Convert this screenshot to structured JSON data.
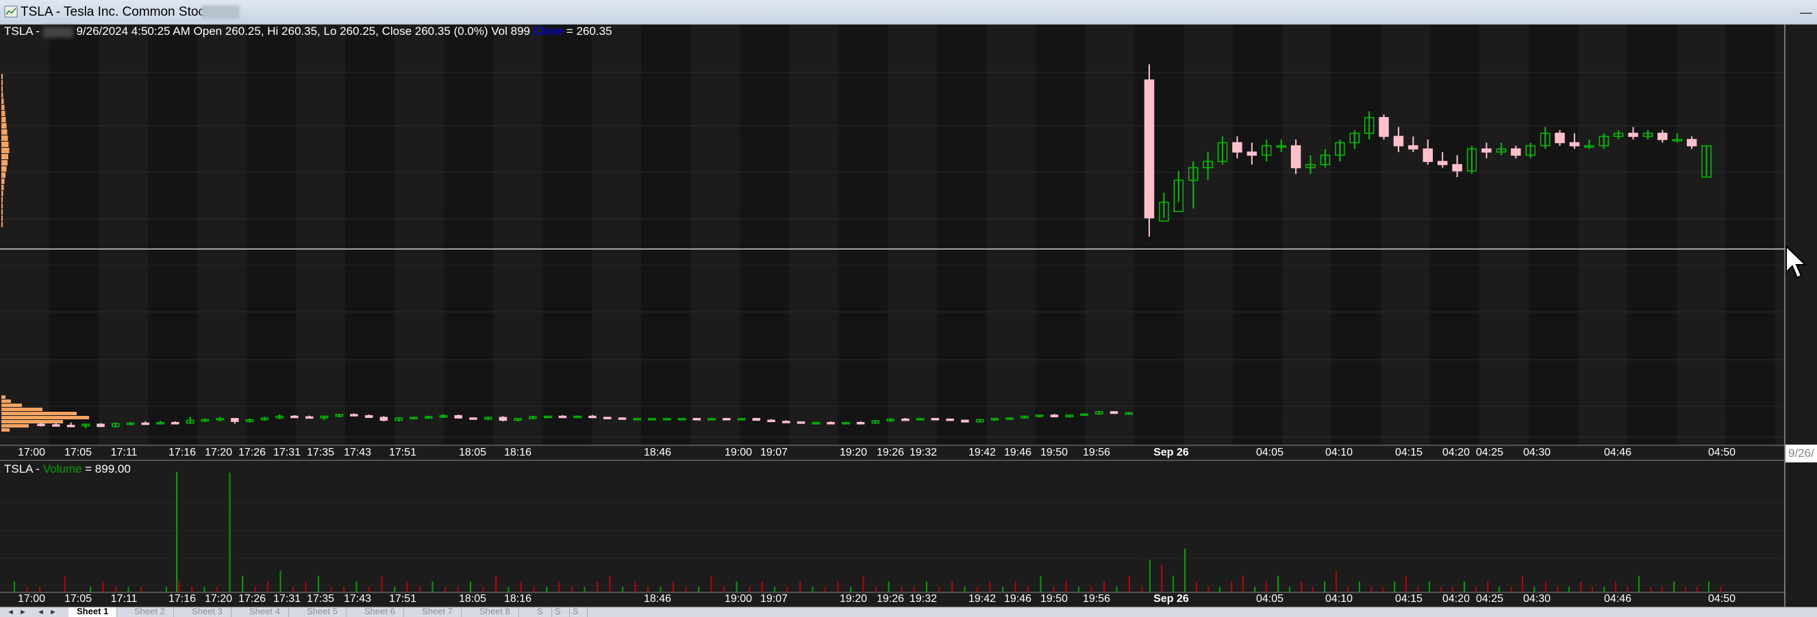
{
  "window": {
    "title": "TSLA - Tesla Inc. Common Stock",
    "minimize_glyph": "—"
  },
  "price_header": {
    "symbol": "TSLA -",
    "details": "9/26/2024 4:50:25 AM Open 260.25, Hi 260.35, Lo 260.25, Close 260.35 (0.0%) Vol 899",
    "close_label": "Close",
    "close_value": "= 260.35"
  },
  "volume_header": {
    "symbol": "TSLA -",
    "label": "Volume",
    "value": "= 899.00"
  },
  "date_tag": "9/26/",
  "colors": {
    "background": "#1c1c1c",
    "band_dark": "#141414",
    "up_candle": "#00c000",
    "down_candle": "#ffc0cb",
    "volume_up": "#00a000",
    "volume_down": "#c00000",
    "volume_profile": "#f4a460",
    "close_label": "#0000ff",
    "volume_label": "#00a000"
  },
  "icons": {
    "window": "chart-window-icon",
    "cursor": "mouse-pointer-icon"
  },
  "x_axis_labels": [
    {
      "text": "17:00",
      "bold": false
    },
    {
      "text": "17:05",
      "bold": false
    },
    {
      "text": "17:11",
      "bold": false
    },
    {
      "text": "17:16",
      "bold": false
    },
    {
      "text": "17:20",
      "bold": false
    },
    {
      "text": "17:26",
      "bold": false
    },
    {
      "text": "17:31",
      "bold": false
    },
    {
      "text": "17:35",
      "bold": false
    },
    {
      "text": "17:43",
      "bold": false
    },
    {
      "text": "17:51",
      "bold": false
    },
    {
      "text": "18:05",
      "bold": false
    },
    {
      "text": "18:16",
      "bold": false
    },
    {
      "text": "18:46",
      "bold": false
    },
    {
      "text": "19:00",
      "bold": false
    },
    {
      "text": "19:07",
      "bold": false
    },
    {
      "text": "19:20",
      "bold": false
    },
    {
      "text": "19:26",
      "bold": false
    },
    {
      "text": "19:32",
      "bold": false
    },
    {
      "text": "19:42",
      "bold": false
    },
    {
      "text": "19:46",
      "bold": false
    },
    {
      "text": "19:50",
      "bold": false
    },
    {
      "text": "19:56",
      "bold": false
    },
    {
      "text": "Sep 26",
      "bold": true
    },
    {
      "text": "04:05",
      "bold": false
    },
    {
      "text": "04:10",
      "bold": false
    },
    {
      "text": "04:15",
      "bold": false
    },
    {
      "text": "04:20",
      "bold": false
    },
    {
      "text": "04:25",
      "bold": false
    },
    {
      "text": "04:30",
      "bold": false
    },
    {
      "text": "04:46",
      "bold": false
    },
    {
      "text": "04:50",
      "bold": false
    }
  ],
  "sheet_nav": [
    "◄",
    "►",
    "◄",
    "►"
  ],
  "sheets": [
    "Sheet 1",
    "Sheet 2",
    "Sheet 3",
    "Sheet 4",
    "Sheet 5",
    "Sheet 6",
    "Sheet 7",
    "Sheet 8",
    "S",
    "S",
    "S"
  ],
  "active_sheet": 0,
  "chart_data": {
    "type": "candlestick",
    "symbol": "TSLA",
    "sessions": [
      {
        "label": "Sep 25 evening (17:00–19:56)",
        "candles": [
          {
            "o": 259.73,
            "h": 259.77,
            "l": 259.69,
            "c": 259.72
          },
          {
            "o": 259.72,
            "h": 259.75,
            "l": 259.7,
            "c": 259.71
          },
          {
            "o": 259.71,
            "h": 259.76,
            "l": 259.68,
            "c": 259.7
          },
          {
            "o": 259.7,
            "h": 259.74,
            "l": 259.66,
            "c": 259.73
          },
          {
            "o": 259.73,
            "h": 259.75,
            "l": 259.68,
            "c": 259.69
          },
          {
            "o": 259.69,
            "h": 259.76,
            "l": 259.67,
            "c": 259.74
          },
          {
            "o": 259.74,
            "h": 259.77,
            "l": 259.71,
            "c": 259.75
          },
          {
            "o": 259.75,
            "h": 259.78,
            "l": 259.72,
            "c": 259.74
          },
          {
            "o": 259.74,
            "h": 259.79,
            "l": 259.73,
            "c": 259.76
          },
          {
            "o": 259.76,
            "h": 259.78,
            "l": 259.73,
            "c": 259.75
          },
          {
            "o": 259.75,
            "h": 259.86,
            "l": 259.74,
            "c": 259.8
          },
          {
            "o": 259.8,
            "h": 259.83,
            "l": 259.77,
            "c": 259.81
          },
          {
            "o": 259.81,
            "h": 259.86,
            "l": 259.78,
            "c": 259.83
          },
          {
            "o": 259.83,
            "h": 259.84,
            "l": 259.74,
            "c": 259.78
          },
          {
            "o": 259.78,
            "h": 259.83,
            "l": 259.76,
            "c": 259.81
          },
          {
            "o": 259.81,
            "h": 259.86,
            "l": 259.79,
            "c": 259.84
          },
          {
            "o": 259.84,
            "h": 259.9,
            "l": 259.82,
            "c": 259.87
          },
          {
            "o": 259.87,
            "h": 259.89,
            "l": 259.84,
            "c": 259.86
          },
          {
            "o": 259.86,
            "h": 259.88,
            "l": 259.83,
            "c": 259.84
          },
          {
            "o": 259.84,
            "h": 259.88,
            "l": 259.8,
            "c": 259.87
          },
          {
            "o": 259.87,
            "h": 259.91,
            "l": 259.85,
            "c": 259.9
          },
          {
            "o": 259.9,
            "h": 259.92,
            "l": 259.87,
            "c": 259.88
          },
          {
            "o": 259.88,
            "h": 259.9,
            "l": 259.84,
            "c": 259.85
          },
          {
            "o": 259.85,
            "h": 259.87,
            "l": 259.78,
            "c": 259.8
          },
          {
            "o": 259.8,
            "h": 259.85,
            "l": 259.78,
            "c": 259.84
          },
          {
            "o": 259.84,
            "h": 259.86,
            "l": 259.82,
            "c": 259.85
          },
          {
            "o": 259.85,
            "h": 259.88,
            "l": 259.83,
            "c": 259.86
          },
          {
            "o": 259.86,
            "h": 259.91,
            "l": 259.84,
            "c": 259.88
          },
          {
            "o": 259.88,
            "h": 259.9,
            "l": 259.83,
            "c": 259.84
          },
          {
            "o": 259.84,
            "h": 259.85,
            "l": 259.81,
            "c": 259.82
          },
          {
            "o": 259.82,
            "h": 259.86,
            "l": 259.8,
            "c": 259.85
          },
          {
            "o": 259.85,
            "h": 259.87,
            "l": 259.78,
            "c": 259.8
          },
          {
            "o": 259.8,
            "h": 259.84,
            "l": 259.78,
            "c": 259.83
          },
          {
            "o": 259.83,
            "h": 259.88,
            "l": 259.82,
            "c": 259.86
          },
          {
            "o": 259.86,
            "h": 259.88,
            "l": 259.85,
            "c": 259.87
          },
          {
            "o": 259.87,
            "h": 259.89,
            "l": 259.85,
            "c": 259.86
          },
          {
            "o": 259.86,
            "h": 259.88,
            "l": 259.85,
            "c": 259.87
          },
          {
            "o": 259.87,
            "h": 259.89,
            "l": 259.84,
            "c": 259.85
          },
          {
            "o": 259.85,
            "h": 259.86,
            "l": 259.83,
            "c": 259.84
          },
          {
            "o": 259.84,
            "h": 259.85,
            "l": 259.82,
            "c": 259.83
          },
          {
            "o": 259.83,
            "h": 259.84,
            "l": 259.82,
            "c": 259.83
          },
          {
            "o": 259.83,
            "h": 259.84,
            "l": 259.82,
            "c": 259.83
          },
          {
            "o": 259.83,
            "h": 259.84,
            "l": 259.82,
            "c": 259.83
          },
          {
            "o": 259.83,
            "h": 259.84,
            "l": 259.82,
            "c": 259.83
          },
          {
            "o": 259.83,
            "h": 259.84,
            "l": 259.81,
            "c": 259.82
          },
          {
            "o": 259.82,
            "h": 259.84,
            "l": 259.81,
            "c": 259.83
          },
          {
            "o": 259.83,
            "h": 259.84,
            "l": 259.8,
            "c": 259.81
          },
          {
            "o": 259.81,
            "h": 259.84,
            "l": 259.8,
            "c": 259.83
          },
          {
            "o": 259.83,
            "h": 259.84,
            "l": 259.79,
            "c": 259.8
          },
          {
            "o": 259.8,
            "h": 259.82,
            "l": 259.77,
            "c": 259.78
          },
          {
            "o": 259.78,
            "h": 259.8,
            "l": 259.76,
            "c": 259.77
          },
          {
            "o": 259.77,
            "h": 259.78,
            "l": 259.74,
            "c": 259.75
          },
          {
            "o": 259.75,
            "h": 259.77,
            "l": 259.73,
            "c": 259.76
          },
          {
            "o": 259.76,
            "h": 259.78,
            "l": 259.74,
            "c": 259.75
          },
          {
            "o": 259.75,
            "h": 259.77,
            "l": 259.74,
            "c": 259.76
          },
          {
            "o": 259.76,
            "h": 259.78,
            "l": 259.74,
            "c": 259.75
          },
          {
            "o": 259.75,
            "h": 259.8,
            "l": 259.74,
            "c": 259.79
          },
          {
            "o": 259.79,
            "h": 259.83,
            "l": 259.77,
            "c": 259.82
          },
          {
            "o": 259.82,
            "h": 259.84,
            "l": 259.79,
            "c": 259.81
          },
          {
            "o": 259.81,
            "h": 259.84,
            "l": 259.8,
            "c": 259.83
          },
          {
            "o": 259.83,
            "h": 259.84,
            "l": 259.81,
            "c": 259.82
          },
          {
            "o": 259.82,
            "h": 259.83,
            "l": 259.79,
            "c": 259.8
          },
          {
            "o": 259.8,
            "h": 259.81,
            "l": 259.76,
            "c": 259.77
          },
          {
            "o": 259.77,
            "h": 259.82,
            "l": 259.76,
            "c": 259.81
          },
          {
            "o": 259.81,
            "h": 259.84,
            "l": 259.79,
            "c": 259.83
          },
          {
            "o": 259.83,
            "h": 259.85,
            "l": 259.81,
            "c": 259.84
          },
          {
            "o": 259.84,
            "h": 259.88,
            "l": 259.83,
            "c": 259.87
          },
          {
            "o": 259.87,
            "h": 259.9,
            "l": 259.85,
            "c": 259.89
          },
          {
            "o": 259.89,
            "h": 259.91,
            "l": 259.85,
            "c": 259.86
          },
          {
            "o": 259.86,
            "h": 259.9,
            "l": 259.85,
            "c": 259.89
          },
          {
            "o": 259.89,
            "h": 259.92,
            "l": 259.88,
            "c": 259.91
          },
          {
            "o": 259.91,
            "h": 259.96,
            "l": 259.9,
            "c": 259.95
          },
          {
            "o": 259.95,
            "h": 259.96,
            "l": 259.91,
            "c": 259.92
          },
          {
            "o": 259.92,
            "h": 259.94,
            "l": 259.9,
            "c": 259.93
          }
        ]
      },
      {
        "label": "Sep 26 pre-market (04:00–04:50)",
        "candles": [
          {
            "o": 260.56,
            "h": 260.61,
            "l": 260.06,
            "c": 260.12
          },
          {
            "o": 260.11,
            "h": 260.2,
            "l": 260.12,
            "c": 260.17
          },
          {
            "o": 260.14,
            "h": 260.27,
            "l": 260.17,
            "c": 260.24
          },
          {
            "o": 260.24,
            "h": 260.3,
            "l": 260.15,
            "c": 260.28
          },
          {
            "o": 260.28,
            "h": 260.33,
            "l": 260.24,
            "c": 260.3
          },
          {
            "o": 260.3,
            "h": 260.38,
            "l": 260.29,
            "c": 260.36
          },
          {
            "o": 260.36,
            "h": 260.38,
            "l": 260.31,
            "c": 260.33
          },
          {
            "o": 260.33,
            "h": 260.36,
            "l": 260.29,
            "c": 260.32
          },
          {
            "o": 260.32,
            "h": 260.37,
            "l": 260.3,
            "c": 260.35
          },
          {
            "o": 260.35,
            "h": 260.37,
            "l": 260.33,
            "c": 260.35
          },
          {
            "o": 260.35,
            "h": 260.37,
            "l": 260.26,
            "c": 260.28
          },
          {
            "o": 260.28,
            "h": 260.32,
            "l": 260.26,
            "c": 260.29
          },
          {
            "o": 260.29,
            "h": 260.34,
            "l": 260.28,
            "c": 260.32
          },
          {
            "o": 260.32,
            "h": 260.37,
            "l": 260.3,
            "c": 260.36
          },
          {
            "o": 260.36,
            "h": 260.4,
            "l": 260.34,
            "c": 260.39
          },
          {
            "o": 260.39,
            "h": 260.46,
            "l": 260.37,
            "c": 260.44
          },
          {
            "o": 260.44,
            "h": 260.45,
            "l": 260.37,
            "c": 260.38
          },
          {
            "o": 260.38,
            "h": 260.41,
            "l": 260.33,
            "c": 260.35
          },
          {
            "o": 260.35,
            "h": 260.38,
            "l": 260.33,
            "c": 260.34
          },
          {
            "o": 260.34,
            "h": 260.37,
            "l": 260.29,
            "c": 260.3
          },
          {
            "o": 260.3,
            "h": 260.33,
            "l": 260.28,
            "c": 260.29
          },
          {
            "o": 260.29,
            "h": 260.32,
            "l": 260.25,
            "c": 260.27
          },
          {
            "o": 260.27,
            "h": 260.35,
            "l": 260.26,
            "c": 260.34
          },
          {
            "o": 260.34,
            "h": 260.36,
            "l": 260.31,
            "c": 260.33
          },
          {
            "o": 260.33,
            "h": 260.36,
            "l": 260.32,
            "c": 260.34
          },
          {
            "o": 260.34,
            "h": 260.35,
            "l": 260.31,
            "c": 260.32
          },
          {
            "o": 260.32,
            "h": 260.36,
            "l": 260.31,
            "c": 260.35
          },
          {
            "o": 260.35,
            "h": 260.41,
            "l": 260.34,
            "c": 260.39
          },
          {
            "o": 260.39,
            "h": 260.4,
            "l": 260.35,
            "c": 260.36
          },
          {
            "o": 260.36,
            "h": 260.39,
            "l": 260.34,
            "c": 260.35
          },
          {
            "o": 260.35,
            "h": 260.37,
            "l": 260.34,
            "c": 260.35
          },
          {
            "o": 260.35,
            "h": 260.39,
            "l": 260.34,
            "c": 260.38
          },
          {
            "o": 260.38,
            "h": 260.4,
            "l": 260.37,
            "c": 260.39
          },
          {
            "o": 260.39,
            "h": 260.41,
            "l": 260.37,
            "c": 260.38
          },
          {
            "o": 260.38,
            "h": 260.4,
            "l": 260.37,
            "c": 260.39
          },
          {
            "o": 260.39,
            "h": 260.4,
            "l": 260.36,
            "c": 260.37
          },
          {
            "o": 260.37,
            "h": 260.39,
            "l": 260.36,
            "c": 260.37
          },
          {
            "o": 260.37,
            "h": 260.38,
            "l": 260.34,
            "c": 260.35
          },
          {
            "o": 260.25,
            "h": 260.35,
            "l": 260.25,
            "c": 260.35
          }
        ]
      }
    ],
    "volume": [
      2,
      1,
      1,
      0,
      3,
      0,
      1,
      2,
      1,
      1,
      1,
      0,
      1,
      2,
      1,
      1,
      1,
      22,
      3,
      1,
      2,
      4,
      1,
      2,
      3,
      1,
      1,
      2,
      1,
      3,
      1,
      2,
      1,
      2,
      1,
      1,
      2,
      1,
      3,
      1,
      2,
      1,
      1,
      2,
      1,
      1,
      2,
      3,
      1,
      2,
      1,
      1,
      2,
      1,
      1,
      3,
      1,
      2,
      1,
      2,
      1,
      1,
      2,
      1,
      1,
      2,
      1,
      3,
      1,
      2,
      1,
      1,
      2,
      1,
      2,
      1,
      1,
      2,
      1,
      2,
      1,
      3,
      1,
      2,
      1,
      1,
      2,
      1,
      3,
      1,
      6,
      5,
      3,
      8,
      2,
      1,
      1,
      2,
      3,
      1,
      2,
      3,
      1,
      2,
      1,
      2,
      4,
      1,
      2,
      1,
      1,
      2,
      3,
      1,
      2,
      1,
      1,
      2,
      1,
      2,
      1,
      1,
      3,
      1,
      2,
      1,
      1,
      2,
      1,
      1,
      2,
      1,
      3,
      1,
      1,
      2,
      1,
      1,
      2,
      1
    ],
    "volume_last": 899.0,
    "last_bar": {
      "datetime": "9/26/2024 4:50:25 AM",
      "open": 260.25,
      "high": 260.35,
      "low": 260.25,
      "close": 260.35,
      "change_pct": 0.0,
      "volume": 899
    }
  }
}
